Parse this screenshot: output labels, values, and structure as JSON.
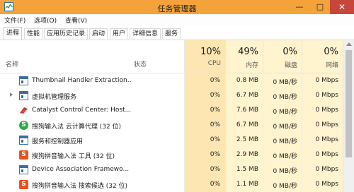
{
  "window": {
    "title": "任务管理器",
    "minimize_icon": "minimize-icon",
    "maximize_icon": "maximize-icon",
    "close_icon": "close-icon"
  },
  "menu": [
    {
      "label": "文件(F)"
    },
    {
      "label": "选项(O)"
    },
    {
      "label": "查看(V)"
    }
  ],
  "tabs": [
    {
      "label": "进程",
      "active": true
    },
    {
      "label": "性能"
    },
    {
      "label": "应用历史记录"
    },
    {
      "label": "启动"
    },
    {
      "label": "用户"
    },
    {
      "label": "详细信息"
    },
    {
      "label": "服务"
    }
  ],
  "columns": {
    "name": "名称",
    "status": "状态",
    "cpu": {
      "percent": "10%",
      "label": "CPU"
    },
    "memory": {
      "percent": "49%",
      "label": "内存"
    },
    "disk": {
      "percent": "0%",
      "label": "磁盘"
    },
    "network": {
      "percent": "0%",
      "label": "网络"
    }
  },
  "processes": [
    {
      "name": "Thumbnail Handler Extraction...",
      "icon": "window-icon",
      "cpu": "0%",
      "memory": "0.8 MB",
      "disk": "0 MB/秒",
      "network": "0 Mbps"
    },
    {
      "name": "虚拟机管理服务",
      "icon": "window-icon",
      "expandable": true,
      "cpu": "0%",
      "memory": "6.7 MB",
      "disk": "0 MB/秒",
      "network": "0 Mbps"
    },
    {
      "name": "Catalyst Control Center: Host...",
      "icon": "catalyst-icon",
      "cpu": "0%",
      "memory": "7.6 MB",
      "disk": "0 MB/秒",
      "network": "0 Mbps"
    },
    {
      "name": "搜狗输入法 云计算代理 (32 位)",
      "icon": "sogou-cloud-icon",
      "cpu": "0%",
      "memory": "6.7 MB",
      "disk": "0 MB/秒",
      "network": "0 Mbps"
    },
    {
      "name": "服务和控制器应用",
      "icon": "window-icon",
      "cpu": "0%",
      "memory": "2.5 MB",
      "disk": "0 MB/秒",
      "network": "0 Mbps"
    },
    {
      "name": "搜狗拼音输入法 工具 (32 位)",
      "icon": "sogou-pinyin-icon",
      "cpu": "0%",
      "memory": "2.9 MB",
      "disk": "0 MB/秒",
      "network": "0 Mbps"
    },
    {
      "name": "Device Association Framewo...",
      "icon": "window-icon",
      "cpu": "0%",
      "memory": "1.5 MB",
      "disk": "0 MB/秒",
      "network": "0 Mbps"
    },
    {
      "name": "搜狗拼音输入法 搜索候选 (32 位)",
      "icon": "sogou-pinyin-icon",
      "cpu": "0%",
      "memory": "1.1 MB",
      "disk": "0 MB/秒",
      "network": "0 Mbps"
    }
  ],
  "colors": {
    "titlebar": "#f3a33a",
    "close_button": "#c7463b",
    "cpu_column": "#fde6b2",
    "resource_column": "#fff4ce"
  }
}
